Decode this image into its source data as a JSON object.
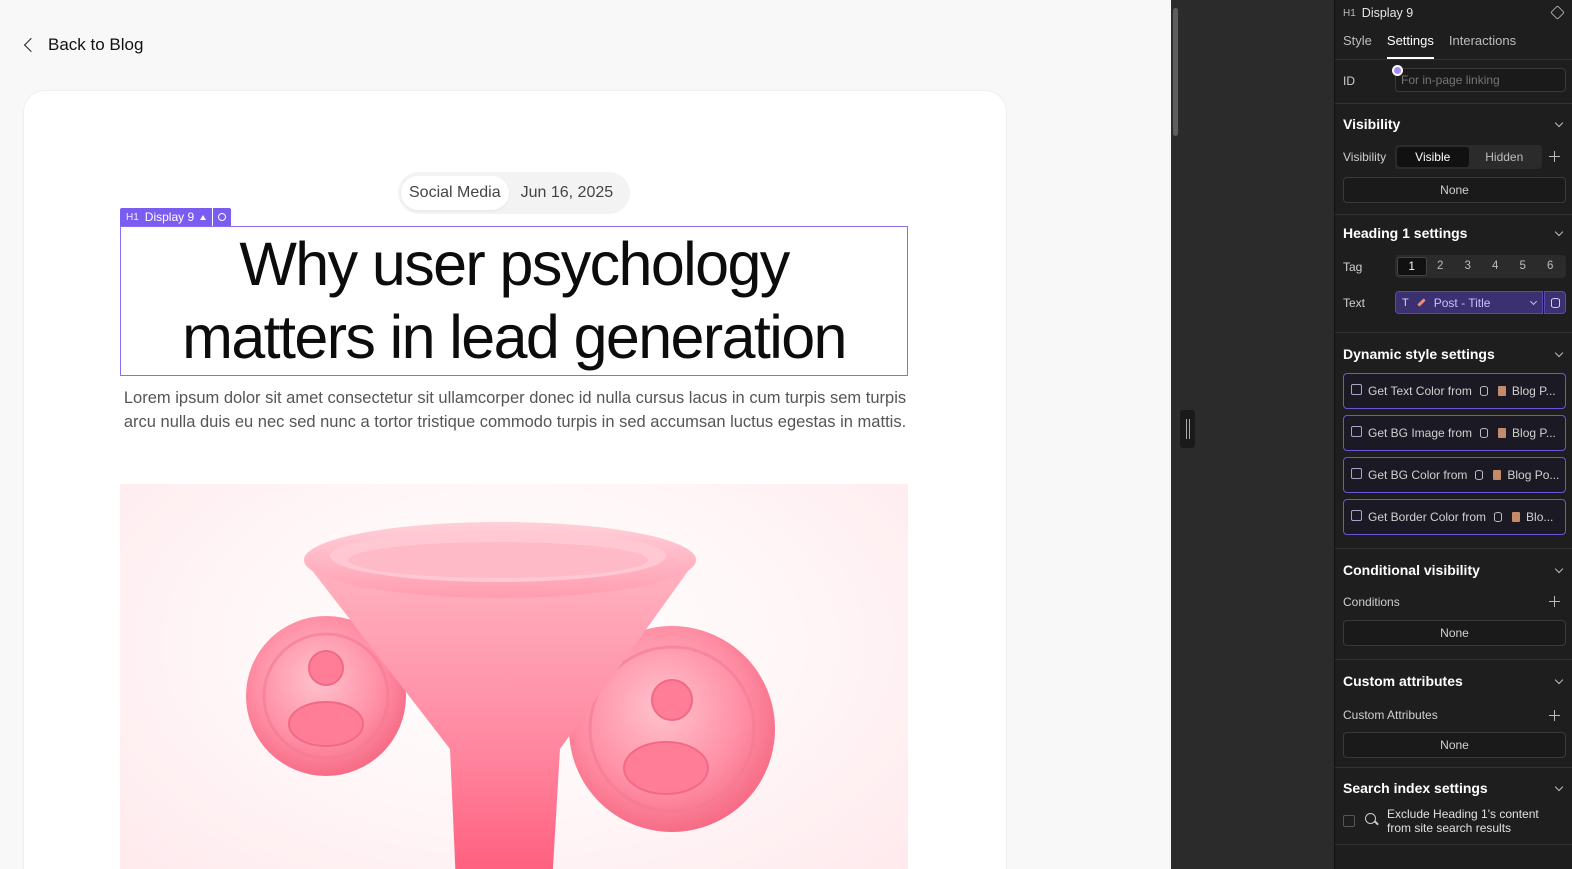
{
  "canvas": {
    "back_link": "Back to Blog",
    "post": {
      "category": "Social Media",
      "date": "Jun 16, 2025",
      "title_line1": "Why user psychology",
      "title_line2": "matters in lead generation",
      "excerpt": "Lorem ipsum dolor sit amet consectetur sit ullamcorper donec id nulla cursus lacus in cum turpis sem turpis arcu nulla duis eu nec sed nunc a tortor tristique commodo turpis in sed accumsan luctus egestas in mattis."
    },
    "selection_label": {
      "tag": "H1",
      "name": "Display 9"
    }
  },
  "panel": {
    "header": {
      "tag": "H1",
      "name": "Display 9",
      "icon": "cube-icon"
    },
    "tabs": [
      {
        "label": "Style",
        "active": false
      },
      {
        "label": "Settings",
        "active": true
      },
      {
        "label": "Interactions",
        "active": false
      }
    ],
    "id_field": {
      "label": "ID",
      "placeholder": "For in-page linking"
    },
    "visibility": {
      "title": "Visibility",
      "label": "Visibility",
      "options": [
        "Visible",
        "Hidden"
      ],
      "selected": "Visible",
      "none": "None"
    },
    "heading_settings": {
      "title": "Heading 1 settings",
      "tag_label": "Tag",
      "tags": [
        "1",
        "2",
        "3",
        "4",
        "5",
        "6"
      ],
      "selected_tag": "1",
      "text_label": "Text",
      "text_type": "T",
      "text_value": "Post - Title"
    },
    "dynamic_style": {
      "title": "Dynamic style settings",
      "items": [
        {
          "label": "Get Text Color from",
          "source": "Blog P..."
        },
        {
          "label": "Get BG Image from",
          "source": "Blog P..."
        },
        {
          "label": "Get BG Color from",
          "source": "Blog Po..."
        },
        {
          "label": "Get Border Color from",
          "source": "Blo..."
        }
      ]
    },
    "conditional": {
      "title": "Conditional visibility",
      "label": "Conditions",
      "none": "None"
    },
    "custom_attributes": {
      "title": "Custom attributes",
      "label": "Custom Attributes",
      "none": "None"
    },
    "search_index": {
      "title": "Search index settings",
      "line1": "Exclude Heading 1's content",
      "line2": "from site search results"
    }
  },
  "colors": {
    "accent": "#7b5cf0",
    "panel_bg": "#1e1e1e",
    "binding_bg": "#3b3170",
    "funnel_pink": "#ff6f8d"
  }
}
